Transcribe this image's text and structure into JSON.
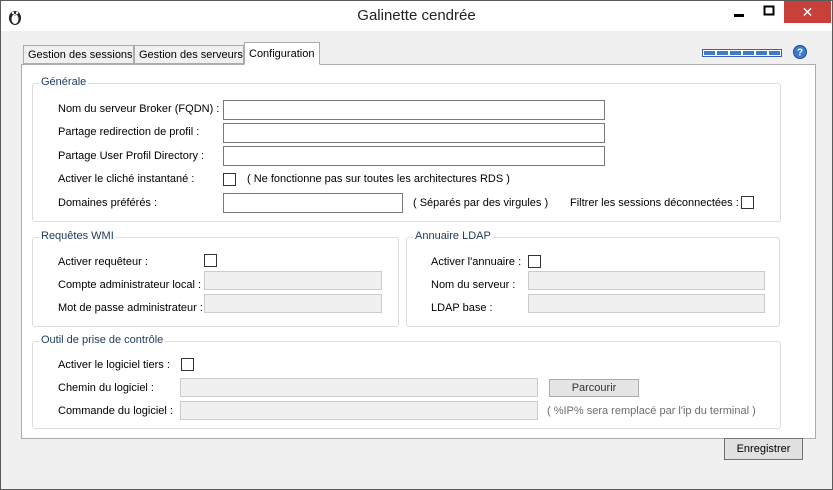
{
  "window": {
    "title": "Galinette cendrée",
    "close_glyph": "✕"
  },
  "tabs": [
    {
      "label": "Gestion des sessions"
    },
    {
      "label": "Gestion des serveurs"
    },
    {
      "label": "Configuration"
    }
  ],
  "generale": {
    "legend": "Générale",
    "broker_label": "Nom du serveur Broker (FQDN) :",
    "broker_value": "",
    "profil_label": "Partage redirection de profil :",
    "profil_value": "",
    "upd_label": "Partage User Profil Directory :",
    "upd_value": "",
    "snapshot_label": "Activer le cliché instantané :",
    "snapshot_hint": "( Ne fonctionne pas sur toutes les architectures RDS )",
    "domains_label": "Domaines préférés :",
    "domains_value": "",
    "domains_hint": "( Séparés par des virgules )",
    "filter_label": "Filtrer les sessions déconnectées :"
  },
  "wmi": {
    "legend": "Requêtes WMI",
    "enable_label": "Activer requêteur :",
    "account_label": "Compte administrateur local :",
    "account_value": "",
    "password_label": "Mot de passe administrateur :",
    "password_value": ""
  },
  "ldap": {
    "legend": "Annuaire LDAP",
    "enable_label": "Activer l'annuaire :",
    "server_label": "Nom du serveur :",
    "server_value": "",
    "base_label": "LDAP base :",
    "base_value": ""
  },
  "outil": {
    "legend": "Outil de prise de contrôle",
    "enable_label": "Activer le logiciel tiers :",
    "path_label": "Chemin du logiciel :",
    "path_value": "",
    "browse_label": "Parcourir",
    "command_label": "Commande du logiciel :",
    "command_value": "",
    "command_hint": "( %IP% sera remplacé par l'ip du terminal )"
  },
  "footer": {
    "save_label": "Enregistrer"
  },
  "colors": {
    "close_bg": "#c7403a",
    "legend_text": "#1e395b",
    "help_blue": "#3b7bd1"
  }
}
